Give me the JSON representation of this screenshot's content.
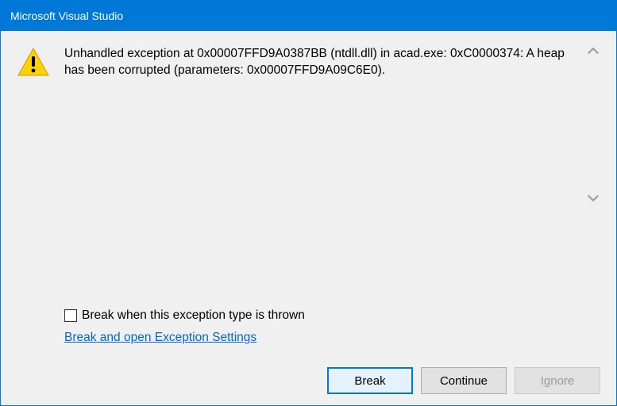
{
  "title": "Microsoft Visual Studio",
  "message": "Unhandled exception at 0x00007FFD9A0387BB (ntdll.dll) in acad.exe: 0xC0000374: A heap has been corrupted (parameters: 0x00007FFD9A09C6E0).",
  "options": {
    "checkbox_label": "Break when this exception type is thrown",
    "link_label": "Break and open Exception Settings"
  },
  "buttons": {
    "break": "Break",
    "continue": "Continue",
    "ignore": "Ignore"
  }
}
